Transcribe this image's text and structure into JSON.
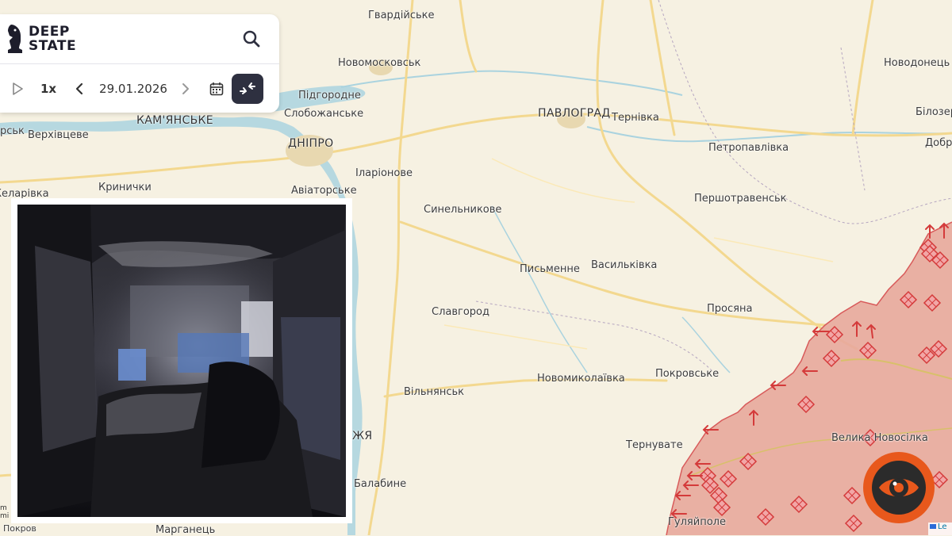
{
  "app": {
    "logo_line1": "DEEP",
    "logo_line2": "STATE",
    "icons": [
      "knight-logo-icon",
      "search-icon",
      "play-icon",
      "chevron-left-icon",
      "chevron-right-icon",
      "calendar-icon",
      "compare-arrows-icon",
      "eye-badge-icon"
    ]
  },
  "timeline": {
    "speed": "1x",
    "date": "29.01.2026"
  },
  "map": {
    "cities": [
      {
        "id": "hvardiiske",
        "name": "Гвардійське"
      },
      {
        "id": "novomoskovsk",
        "name": "Новомосковськ"
      },
      {
        "id": "novodonetske",
        "name": "Новодонець"
      },
      {
        "id": "pidhorodne",
        "name": "Підгородне"
      },
      {
        "id": "slobozhanske",
        "name": "Слобожанське"
      },
      {
        "id": "kamianske",
        "name": "КАМ'ЯНСЬКЕ"
      },
      {
        "id": "pavlohrad",
        "name": "ПАВЛОГРАД"
      },
      {
        "id": "ternivka",
        "name": "Тернівка"
      },
      {
        "id": "bilozerske",
        "name": "Білозер"
      },
      {
        "id": "dobropillia",
        "name": "Добр"
      },
      {
        "id": "verkhivtseve",
        "name": "Верхівцеве"
      },
      {
        "id": "rsk",
        "name": "рськ"
      },
      {
        "id": "dnipro",
        "name": "ДНІПРО"
      },
      {
        "id": "petropavlivka",
        "name": "Петропавлівка"
      },
      {
        "id": "ilarionove",
        "name": "Іларіонове"
      },
      {
        "id": "krynychky",
        "name": "Кринички"
      },
      {
        "id": "aviatorske",
        "name": "Авіаторське"
      },
      {
        "id": "zhovti-vody",
        "name": "Желарівка"
      },
      {
        "id": "pershotravensk",
        "name": "Першотравенськ"
      },
      {
        "id": "synelnykove",
        "name": "Синельникове"
      },
      {
        "id": "pysmenne",
        "name": "Письменне"
      },
      {
        "id": "vasylkivka",
        "name": "Васильківка"
      },
      {
        "id": "prosiana",
        "name": "Просяна"
      },
      {
        "id": "slavhorod",
        "name": "Славгород"
      },
      {
        "id": "novomykolaivka",
        "name": "Новомиколаївка"
      },
      {
        "id": "pokrovske",
        "name": "Покровське"
      },
      {
        "id": "vilniansk",
        "name": "Вільнянськ"
      },
      {
        "id": "ternuvate",
        "name": "Тернувате"
      },
      {
        "id": "velyka-novosilka",
        "name": "Велика Новосілка"
      },
      {
        "id": "zhia",
        "name": "ЖЯ"
      },
      {
        "id": "balabyne",
        "name": "Балабине"
      },
      {
        "id": "marhanets",
        "name": "Марганець"
      },
      {
        "id": "huliaipole",
        "name": "Гуляйполе"
      }
    ],
    "attribution": "Le",
    "scale_labels": [
      "m",
      "mi"
    ],
    "cut_label": "Покров"
  },
  "colors": {
    "land": "#f6f1e2",
    "road": "#f3d88f",
    "water": "#aad3df",
    "occupied": "#e8a99c",
    "front_line": "#d85a5a",
    "panel_dark": "#2e3040",
    "badge": "#e8581c"
  }
}
